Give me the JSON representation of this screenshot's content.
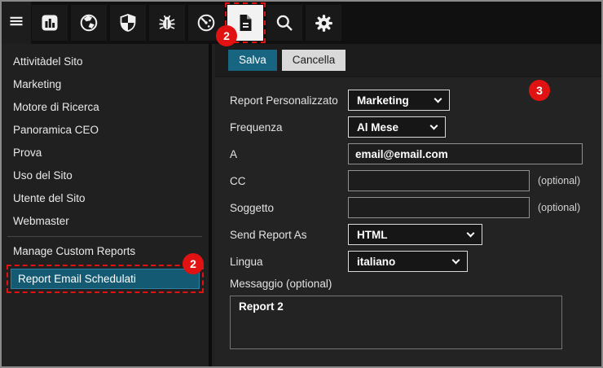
{
  "colors": {
    "annotation_red": "#e01212",
    "accent_teal": "#176580",
    "selection_bg": "#145a73",
    "selected_tile_bg": "#f2f2f2"
  },
  "toolbar": {
    "icons": [
      "menu-icon",
      "bar-chart-icon",
      "globe-icon",
      "shield-icon",
      "bug-icon",
      "speedometer-icon",
      "document-icon",
      "search-icon",
      "gear-icon"
    ],
    "selected_icon": "document-icon"
  },
  "annotations": {
    "toolbar_badge": "2",
    "sidebar_badge": "2",
    "content_badge": "3"
  },
  "sidebar": {
    "items": [
      "Attivitàdel Sito",
      "Marketing",
      "Motore di Ricerca",
      "Panoramica CEO",
      "Prova",
      "Uso del Sito",
      "Utente del Sito",
      "Webmaster"
    ],
    "manage_label": "Manage Custom Reports",
    "selected_label": "Report Email Schedulati"
  },
  "content": {
    "save_label": "Salva",
    "cancel_label": "Cancella",
    "fields": [
      {
        "label": "Report Personalizzato",
        "control": "select",
        "value": "Marketing"
      },
      {
        "label": "Frequenza",
        "control": "select",
        "value": "Al Mese"
      },
      {
        "label": "A",
        "control": "text",
        "value": "email@email.com"
      },
      {
        "label": "CC",
        "control": "text",
        "value": "",
        "suffix": "(optional)"
      },
      {
        "label": "Soggetto",
        "control": "text",
        "value": "",
        "suffix": "(optional)"
      },
      {
        "label": "Send Report As",
        "control": "select",
        "value": "HTML"
      },
      {
        "label": "Lingua",
        "control": "select",
        "value": "italiano"
      }
    ],
    "message": {
      "label": "Messaggio (optional)",
      "value": "Report 2"
    }
  }
}
